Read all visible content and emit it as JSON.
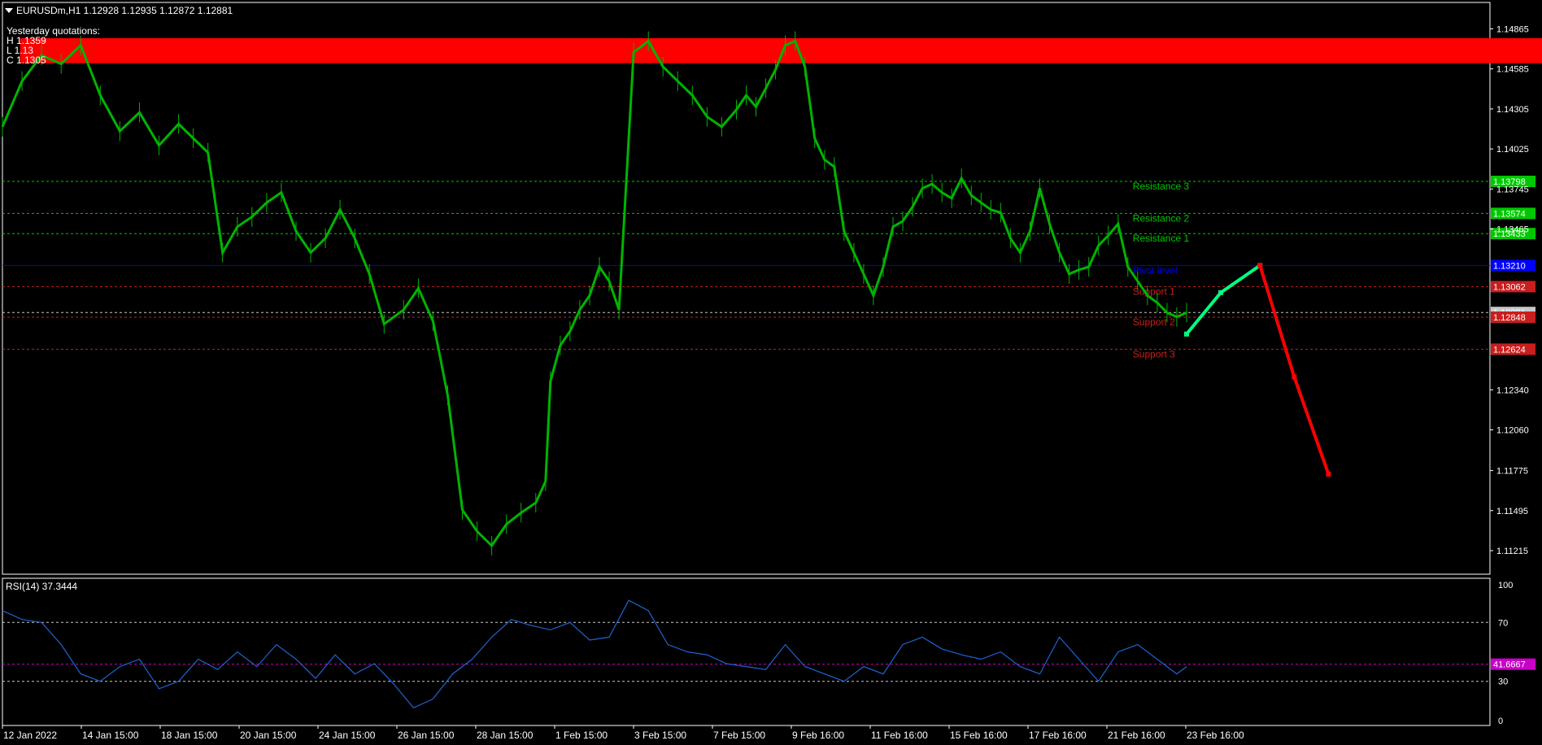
{
  "colors": {
    "background": "#000000",
    "price_line": "#00b400",
    "rsi_line": "#1e64d2",
    "resistance": "#00c800",
    "support": "#c81e1e",
    "pivot": "#0000ff",
    "zone": "#ff0000",
    "projection_up": "#00ff80",
    "projection_down": "#ff0000",
    "rsi_level": "#c8c8c8",
    "rsi_current_level": "#c800c8"
  },
  "header": {
    "symbol_line": "EURUSDm,H1  1.12928 1.12935 1.12872 1.12881",
    "dropdown_icon": "triangle-down-icon"
  },
  "yesterday": {
    "title": "Yesterday quotations:",
    "high": "H 1.1359",
    "low": "L 1.13",
    "close": "C 1.1305"
  },
  "rsi_panel": {
    "label": "RSI(14) 37.3444",
    "current_marker": "41.6667",
    "scale": [
      "100",
      "70",
      "30",
      "0"
    ]
  },
  "chart_data": [
    {
      "type": "line",
      "name": "price",
      "ylim": [
        1.1105,
        1.1505
      ],
      "y_ticks": [
        "1.14865",
        "1.14585",
        "1.14305",
        "1.14025",
        "1.13745",
        "1.13465",
        "1.12340",
        "1.12060",
        "1.11775",
        "1.11495",
        "1.11215"
      ],
      "x_ticks": [
        "12 Jan 2022",
        "14 Jan 15:00",
        "18 Jan 15:00",
        "20 Jan 15:00",
        "24 Jan 15:00",
        "26 Jan 15:00",
        "28 Jan 15:00",
        "1 Feb 15:00",
        "3 Feb 15:00",
        "7 Feb 15:00",
        "9 Feb 16:00",
        "11 Feb 16:00",
        "15 Feb 16:00",
        "17 Feb 16:00",
        "21 Feb 16:00",
        "23 Feb 16:00"
      ],
      "series": [
        {
          "x": [
            0,
            20,
            40,
            60,
            80,
            100,
            120,
            140,
            160,
            180,
            195,
            210,
            225,
            240,
            255,
            270,
            285,
            300,
            315,
            330,
            345,
            360,
            375,
            390,
            410,
            425,
            440,
            455,
            470,
            485,
            500,
            515,
            530,
            545,
            555,
            560,
            570,
            580,
            590,
            600,
            610,
            620,
            630,
            645,
            660,
            675,
            690,
            705,
            720,
            735,
            750,
            760,
            770,
            780,
            790,
            800,
            810,
            820,
            830,
            840,
            850,
            860,
            870,
            880,
            890,
            900,
            910,
            920,
            930,
            940,
            950,
            960,
            970,
            980,
            990,
            1000,
            1010,
            1020,
            1030,
            1040,
            1050,
            1060,
            1070,
            1080,
            1090,
            1100,
            1110,
            1120,
            1130,
            1140,
            1150,
            1160,
            1170,
            1180,
            1190,
            1200,
            1210
          ],
          "y": [
            1.1418,
            1.145,
            1.1468,
            1.1462,
            1.1475,
            1.144,
            1.1415,
            1.1428,
            1.1405,
            1.142,
            1.141,
            1.14,
            1.133,
            1.1348,
            1.1355,
            1.1365,
            1.1372,
            1.1345,
            1.133,
            1.134,
            1.136,
            1.134,
            1.1315,
            1.128,
            1.129,
            1.1305,
            1.1282,
            1.123,
            1.115,
            1.1135,
            1.1125,
            1.114,
            1.1148,
            1.1155,
            1.117,
            1.124,
            1.1265,
            1.1275,
            1.129,
            1.13,
            1.132,
            1.131,
            1.129,
            1.147,
            1.1478,
            1.146,
            1.145,
            1.144,
            1.1425,
            1.1418,
            1.143,
            1.144,
            1.1432,
            1.1445,
            1.1458,
            1.1475,
            1.1478,
            1.146,
            1.141,
            1.1395,
            1.139,
            1.1345,
            1.133,
            1.1315,
            1.13,
            1.132,
            1.1348,
            1.1352,
            1.1362,
            1.1375,
            1.1378,
            1.1372,
            1.1368,
            1.1382,
            1.137,
            1.1365,
            1.136,
            1.1358,
            1.134,
            1.133,
            1.1345,
            1.1375,
            1.135,
            1.133,
            1.1315,
            1.1318,
            1.132,
            1.1335,
            1.1342,
            1.135,
            1.132,
            1.131,
            1.13,
            1.1295,
            1.1288,
            1.1285,
            1.1288
          ]
        }
      ],
      "levels": [
        {
          "label": "Resistance 3",
          "value": 1.13798,
          "tag": "1.13798"
        },
        {
          "label": "Resistance 2",
          "value": 1.13574,
          "tag": "1.13574"
        },
        {
          "label": "Resistance 1",
          "value": 1.13433,
          "tag": "1.13433"
        },
        {
          "label": "Pivot level",
          "value": 1.1321,
          "tag": "1.13210"
        },
        {
          "label": "Support 1",
          "value": 1.13062,
          "tag": "1.13062"
        },
        {
          "label": "",
          "value": 1.12881,
          "tag": "1.12881"
        },
        {
          "label": "Support 2",
          "value": 1.12848,
          "tag": "1.12848"
        },
        {
          "label": "Support 3",
          "value": 1.12624,
          "tag": "1.12624"
        }
      ],
      "zone": {
        "from": 1.14625,
        "to": 1.148
      },
      "projection": {
        "up": [
          [
            1210,
            1.1273
          ],
          [
            1245,
            1.1302
          ],
          [
            1285,
            1.1321
          ]
        ],
        "down": [
          [
            1285,
            1.1321
          ],
          [
            1320,
            1.1243
          ],
          [
            1355,
            1.1175
          ]
        ]
      },
      "x_range": [
        0,
        1520
      ]
    },
    {
      "type": "line",
      "name": "RSI(14)",
      "ylim": [
        0,
        100
      ],
      "levels": [
        70,
        41.6667,
        30
      ],
      "series": [
        {
          "x": [
            0,
            20,
            40,
            60,
            80,
            100,
            120,
            140,
            160,
            180,
            200,
            220,
            240,
            260,
            280,
            300,
            320,
            340,
            360,
            380,
            400,
            420,
            440,
            460,
            480,
            500,
            520,
            540,
            560,
            580,
            600,
            620,
            640,
            660,
            680,
            700,
            720,
            740,
            760,
            780,
            800,
            820,
            840,
            860,
            880,
            900,
            920,
            940,
            960,
            980,
            1000,
            1020,
            1040,
            1060,
            1080,
            1100,
            1120,
            1140,
            1160,
            1180,
            1200,
            1210
          ],
          "y": [
            78,
            72,
            70,
            55,
            35,
            30,
            40,
            45,
            25,
            30,
            45,
            38,
            50,
            40,
            55,
            45,
            32,
            48,
            35,
            42,
            28,
            12,
            18,
            35,
            45,
            60,
            72,
            68,
            65,
            70,
            58,
            60,
            85,
            78,
            55,
            50,
            48,
            42,
            40,
            38,
            55,
            40,
            35,
            30,
            40,
            35,
            55,
            60,
            52,
            48,
            45,
            50,
            40,
            35,
            60,
            45,
            30,
            50,
            55,
            45,
            35,
            40
          ]
        }
      ]
    }
  ]
}
